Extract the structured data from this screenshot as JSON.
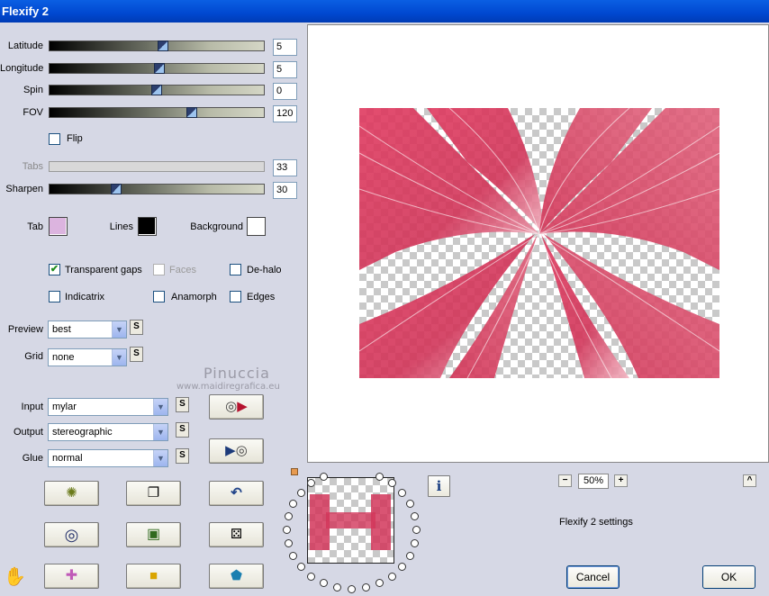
{
  "window": {
    "title": "Flexify 2"
  },
  "sliders": [
    {
      "label": "Latitude",
      "value": "5",
      "position": 0.52
    },
    {
      "label": "Longitude",
      "value": "5",
      "position": 0.51
    },
    {
      "label": "Spin",
      "value": "0",
      "position": 0.5
    },
    {
      "label": "FOV",
      "value": "120",
      "position": 0.66
    }
  ],
  "flip": {
    "label": "Flip",
    "checked": false
  },
  "tabs": {
    "label": "Tabs",
    "value": "33"
  },
  "sharpen": {
    "label": "Sharpen",
    "value": "30",
    "position": 0.31
  },
  "colors": {
    "tab_label": "Tab",
    "tab_color": "#dcb4df",
    "lines_label": "Lines",
    "lines_color": "#000000",
    "background_label": "Background",
    "background_color": "#ffffff"
  },
  "options": {
    "transparent_gaps": "Transparent gaps",
    "faces": "Faces",
    "de_halo": "De-halo",
    "indicatrix": "Indicatrix",
    "anamorph": "Anamorph",
    "edges": "Edges"
  },
  "preview": {
    "label": "Preview",
    "value": "best",
    "s": "S"
  },
  "grid": {
    "label": "Grid",
    "value": "none",
    "s": "S"
  },
  "watermark": {
    "name": "Pinuccia",
    "site": "www.maidiregrafica.eu"
  },
  "input": {
    "label": "Input",
    "value": "mylar",
    "s": "S"
  },
  "output": {
    "label": "Output",
    "value": "stereographic",
    "s": "S"
  },
  "glue": {
    "label": "Glue",
    "value": "normal",
    "s": "S"
  },
  "zoom": {
    "minus": "−",
    "value": "50%",
    "plus": "+"
  },
  "settings_title": "Flexify 2 settings",
  "info_button": "i",
  "up_button": "^",
  "buttons": {
    "cancel": "Cancel",
    "ok": "OK"
  },
  "accent": {
    "ribbon": "#d2365a",
    "window_title": "#0050d8"
  }
}
